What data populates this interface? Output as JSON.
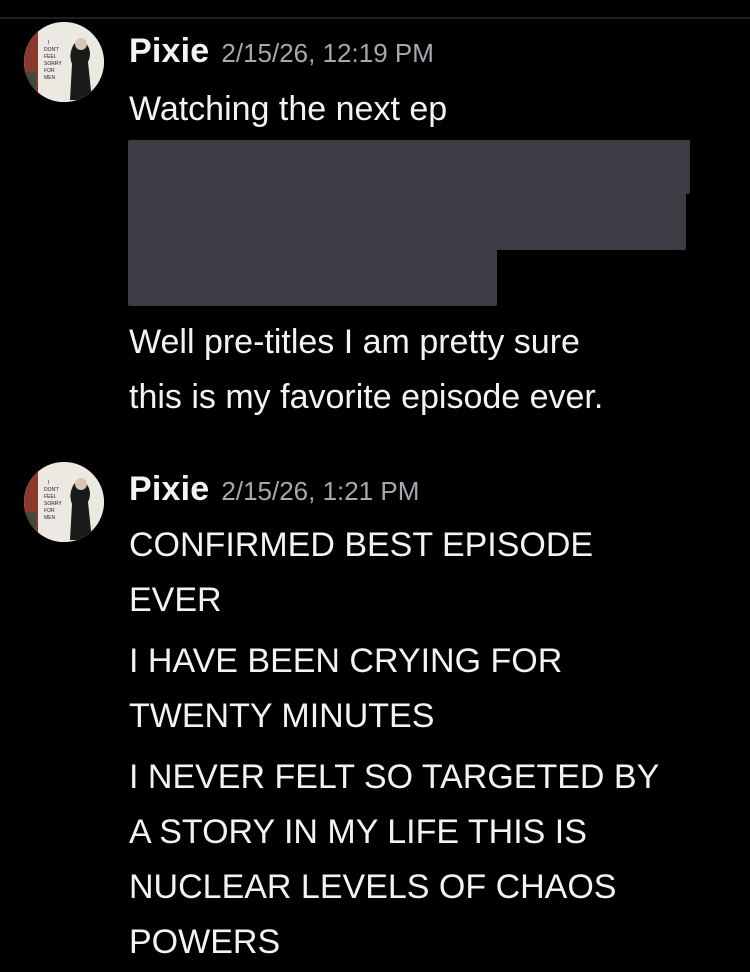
{
  "messages": [
    {
      "username": "Pixie",
      "timestamp": "2/15/26, 12:19 PM",
      "lines": [
        "Watching the next ep",
        "Well pre-titles I am pretty sure\nthis is my favorite episode ever."
      ],
      "attachment": "redacted-image"
    },
    {
      "username": "Pixie",
      "timestamp": "2/15/26, 1:21 PM",
      "lines": [
        "CONFIRMED BEST EPISODE\nEVER",
        "I HAVE BEEN CRYING FOR\nTWENTY MINUTES",
        "I NEVER FELT SO TARGETED BY\nA STORY IN MY LIFE THIS IS\nNUCLEAR LEVELS OF CHAOS\nPOWERS"
      ]
    }
  ],
  "avatar": {
    "poster_text": [
      "I",
      "DON'T",
      "FEEL",
      "SORRY",
      "FOR",
      "MEN"
    ]
  },
  "colors": {
    "background": "#000000",
    "text": "#f2f3f5",
    "timestamp": "#a6a8af",
    "redaction": "#3c3d44"
  }
}
